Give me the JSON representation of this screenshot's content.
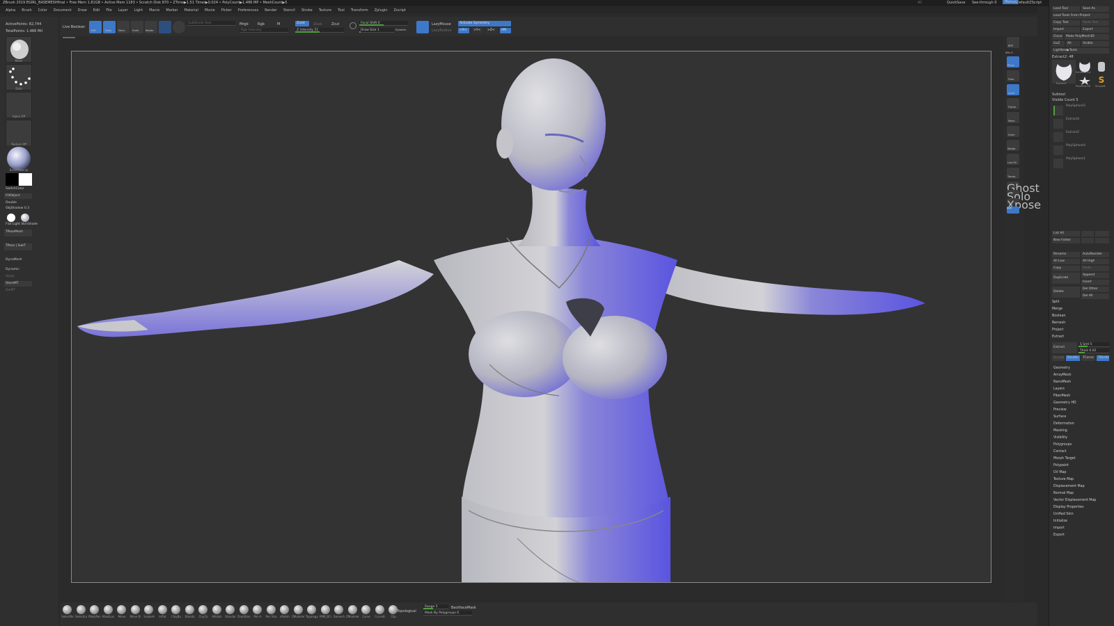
{
  "titlebar": {
    "text": "ZBrush 2019   EGIRL_BASEMESHfinal   • Free Mem 1.81GB • Active Mem 1183 • Scratch Disk 870 • ZTime▶1.51 Timer▶0.024 • PolyCount▶1.486 MP • MeshCount▶5",
    "ac": "AC",
    "quicksave": "QuickSave",
    "seethrough": "See-through  0",
    "menus": "Menus",
    "script": "DefaultZScript"
  },
  "menubar": [
    "Alpha",
    "Brush",
    "Color",
    "Document",
    "Draw",
    "Edit",
    "File",
    "Layer",
    "Light",
    "Macro",
    "Marker",
    "Material",
    "Movie",
    "Picker",
    "Preferences",
    "Render",
    "Stencil",
    "Stroke",
    "Texture",
    "Tool",
    "Transform",
    "Zplugin",
    "Zscript"
  ],
  "stats": {
    "active_points": "ActivePoints: 82,744",
    "total_points": "TotalPoints: 1.486 Mil"
  },
  "left_shelf": {
    "brush": "Move",
    "stroke": "Dots",
    "alpha": "Alpha Off",
    "texture": "Texture Off",
    "material": "BasicMaterial",
    "switch_color": "SwitchColor",
    "fill_object": "FillObject",
    "double": "Double",
    "obj_shadow": "ObjShadow 0.3",
    "flat_light": "Flat Light  SkinShade",
    "tpose_mesh": "TPoseMesh",
    "tpose_subt": "TPose | SubT",
    "dynamesh": "DynaMesh",
    "dynamic": "Dynamic",
    "apply": "Apply",
    "store_mt": "StoreMT",
    "del_mt": "DelMT"
  },
  "toolbar": {
    "live_boolean": "Live Boolean",
    "edit": "Edit",
    "draw": "Draw",
    "move": "Move",
    "scale": "Scale",
    "rotate": "Rotate",
    "subdiv": "SubDivide Size",
    "mrgb": "Mrgb",
    "rgb": "Rgb",
    "m": "M",
    "rgb_intensity": "Rgb Intensity",
    "zadd": "Zadd",
    "zsub": "Zsub",
    "zcut": "Zcut",
    "z_intensity": "Z Intensity 51",
    "focal_shift": "Focal Shift 0",
    "draw_size": "Draw Size 1",
    "dynamic": "Dynamic",
    "lazymouse": "LazyMouse",
    "lazyradius": "LazyRadius",
    "symmetry": "Activate Symmetry",
    "sym_x": ">X<",
    "sym_y": ">Y<",
    "sym_z": ">Z<",
    "sym_m": "(M)"
  },
  "right_shelf": [
    "BPR",
    "SPix 3",
    "Persp",
    "Floor",
    "Local",
    "Frame",
    "Move",
    "Scale",
    "Rotate",
    "Line Fill",
    "Transp",
    "Ghost",
    "Solo",
    "Xpose",
    "Dyn"
  ],
  "tool_panel": {
    "load_tool": "Load Tool",
    "save_as": "Save As",
    "load_project": "Load Tools From Project",
    "copy_tool": "Copy Tool",
    "paste_tool": "Paste Tool",
    "import": "Import",
    "export": "Export",
    "clone": "Clone",
    "make_polymesh": "Make PolyMesh3D",
    "goz": "GoZ",
    "all": "All",
    "visible": "Visible",
    "lightbox": "Lightbox▶Tools",
    "current_tool": "Extract2: 48",
    "tool_thumbs": [
      "Extract2",
      "Extract2  Cyl",
      "SimpleB",
      "PolyMesh3D",
      "SimpleB"
    ],
    "subtool_header": "Subtool",
    "visible_count": "Visible Count 5",
    "subtools": [
      "PolySphere5",
      "Extract4",
      "Extract2",
      "PolySphere4",
      "PolySphere1"
    ],
    "list_all": "List All",
    "new_folder": "New Folder",
    "rename": "Rename",
    "auto_reorder": "AutoReorder",
    "all_low": "All Low",
    "all_high": "All High",
    "copy": "Copy",
    "paste": "Paste",
    "duplicate": "Duplicate",
    "append": "Append",
    "insert": "Insert",
    "delete": "Delete",
    "del_other": "Del Other",
    "del_all": "Del All",
    "split": "Split",
    "merge": "Merge",
    "boolean": "Boolean",
    "remesh": "Remesh",
    "project": "Project",
    "extract_section": "Extract",
    "extract_btn": "Extract",
    "smt": "S Smt 5",
    "thick": "Thick 0.02",
    "accept": "Accept",
    "double": "Double",
    "tcorne": "TCorne",
    "tborde": "TBorde",
    "menu": [
      "Geometry",
      "ArrayMesh",
      "NanoMesh",
      "Layers",
      "FiberMesh",
      "Geometry HD",
      "Preview",
      "Surface",
      "Deformation",
      "Masking",
      "Visibility",
      "Polygroups",
      "Contact",
      "Morph Target",
      "Polypaint",
      "UV Map",
      "Texture Map",
      "Displacement Map",
      "Normal Map",
      "Vector Displacement Map",
      "Display Properties",
      "Unified Skin",
      "Initialize",
      "Import",
      "Export"
    ]
  },
  "bottom_shelf": {
    "brushes": [
      "SelectRe",
      "SelectLa",
      "MaskPen",
      "MaskLas",
      "Move",
      "Move El",
      "SnakeH",
      "Inflat",
      "ClayBu",
      "Standa",
      "ClayTu",
      "hPolish",
      "Standar",
      "DamStan",
      "Pen A",
      "Pen Sha",
      "sPolish",
      "ZModeler",
      "Topology",
      "IMM_BCI",
      "Remesh",
      "ZModeler",
      "Curve",
      "CurveB",
      "Clip"
    ],
    "topological": "Topological",
    "range": "Range 5",
    "backface_mask": "BackfaceMask",
    "mask_polygroups": "Mask By Polygroups 0"
  },
  "colors": {
    "accent": "#3e78c8",
    "panel": "#2f2f2f",
    "canvas": "#333333",
    "green": "#50a040",
    "gold": "#e0a020"
  }
}
